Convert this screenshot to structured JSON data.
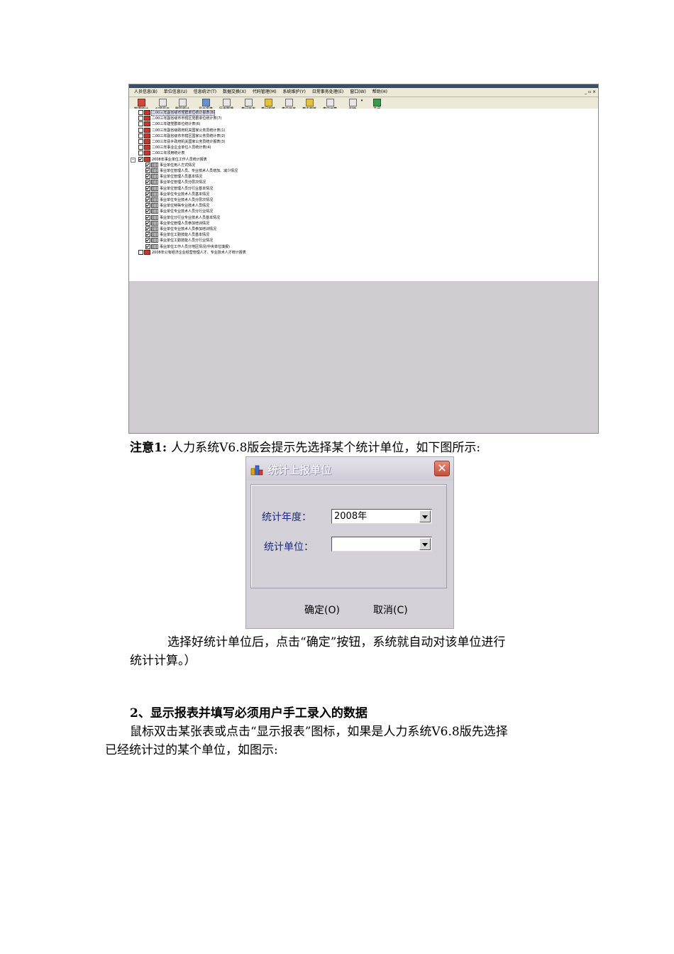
{
  "screenshot": {
    "menu": [
      "人员信息(B)",
      "单位信息(U)",
      "信息统计(T)",
      "数据交换(X)",
      "代码管理(M)",
      "系统维护(Y)",
      "日常事务处理(E)",
      "窗口(W)",
      "帮助(H)"
    ],
    "window_controls": "_ ▫ ×",
    "toolbar": [
      "数据统计",
      "纠错显示",
      "删除统计",
      "显示报表",
      "历史数据",
      "表间日志",
      "表间校核",
      "表内日志",
      "表内校核",
      "表内运算",
      "封面",
      "",
      "关闭"
    ],
    "tree": [
      {
        "label": "二00三年副省级市党群单位统计报表(8)",
        "checked": false,
        "type": "book",
        "selected": true
      },
      {
        "label": "二00三年副省级市市辖区党群单位统计表(7)",
        "checked": false,
        "type": "book"
      },
      {
        "label": "二00三年建党群单位统计表(6)",
        "checked": false,
        "type": "book"
      },
      {
        "label": "二00三年副省级政府机关国家公务员统计表(1)",
        "checked": false,
        "type": "book"
      },
      {
        "label": "二00三年副省级市市辖区国家公务员统计表(2)",
        "checked": false,
        "type": "book"
      },
      {
        "label": "二00三年县乡政府机关国家公务员统计报表(3)",
        "checked": false,
        "type": "book"
      },
      {
        "label": "二00三年事业企业单位人员统计表(4)",
        "checked": false,
        "type": "book"
      },
      {
        "label": "二00三年须用统计表",
        "checked": false,
        "type": "book"
      },
      {
        "label": "2008年事业单位工作人员统计报表",
        "checked": true,
        "type": "book",
        "expanded": true
      },
      {
        "label": "事业单位用人方式情况",
        "checked": true,
        "type": "table",
        "child": true
      },
      {
        "label": "事业单位管理人员、专业技术人员增加、减少情况",
        "checked": true,
        "type": "table",
        "child": true
      },
      {
        "label": "事业单位管理人员基本情况",
        "checked": true,
        "type": "table",
        "child": true
      },
      {
        "label": "事业单位管理人员分层次情况",
        "checked": true,
        "type": "table",
        "child": true
      },
      {
        "label": "事业单位管理人员分行业基本情况",
        "checked": true,
        "type": "table",
        "child": true
      },
      {
        "label": "事业单位专业技术人员基本情况",
        "checked": true,
        "type": "table",
        "child": true
      },
      {
        "label": "事业单位专业技术人员分层次情况",
        "checked": true,
        "type": "table",
        "child": true
      },
      {
        "label": "事业单位特殊专业技术人员情况",
        "checked": true,
        "type": "table",
        "child": true
      },
      {
        "label": "事业单位专业技术人员分行业情况",
        "checked": true,
        "type": "table",
        "child": true
      },
      {
        "label": "事业单位分行业专业技术人员基本情况",
        "checked": true,
        "type": "table",
        "child": true
      },
      {
        "label": "事业单位管理人员参加培训情况",
        "checked": true,
        "type": "table",
        "child": true
      },
      {
        "label": "事业单位专业技术人员参加培训情况",
        "checked": true,
        "type": "table",
        "child": true
      },
      {
        "label": "事业单位工勤技能人员基本情况",
        "checked": true,
        "type": "table",
        "child": true
      },
      {
        "label": "事业单位工勤技能人员分行业情况",
        "checked": true,
        "type": "table",
        "child": true
      },
      {
        "label": "事业单位工作人员分地区情况(中央单位填报)",
        "checked": true,
        "type": "table",
        "child": true
      },
      {
        "label": "2008年公有经济企业经营管理人才、专业技术人才统计报表",
        "checked": false,
        "type": "book"
      }
    ]
  },
  "note1": {
    "bold": "注意1:",
    "text": "人力系统V6.8版会提示先选择某个统计单位，如下图所示:"
  },
  "dialog": {
    "title": "统计上报单位",
    "year_label": "统计年度：",
    "year_value": "2008年",
    "unit_label": "统计单位：",
    "unit_value": "",
    "ok": "确定(O)",
    "cancel": "取消(C)"
  },
  "after_dialog": {
    "line1": "选择好统计单位后，点击“确定”按钮，系统就自动对该单位进行",
    "line2": "统计计算。）"
  },
  "section2": {
    "heading": "2、显示报表并填写必须用户手工录入的数据",
    "line1": "鼠标双击某张表或点击“显示报表”图标，如果是人力系统V6.8版先选择",
    "line2": "已经统计过的某个单位，如图示:"
  }
}
